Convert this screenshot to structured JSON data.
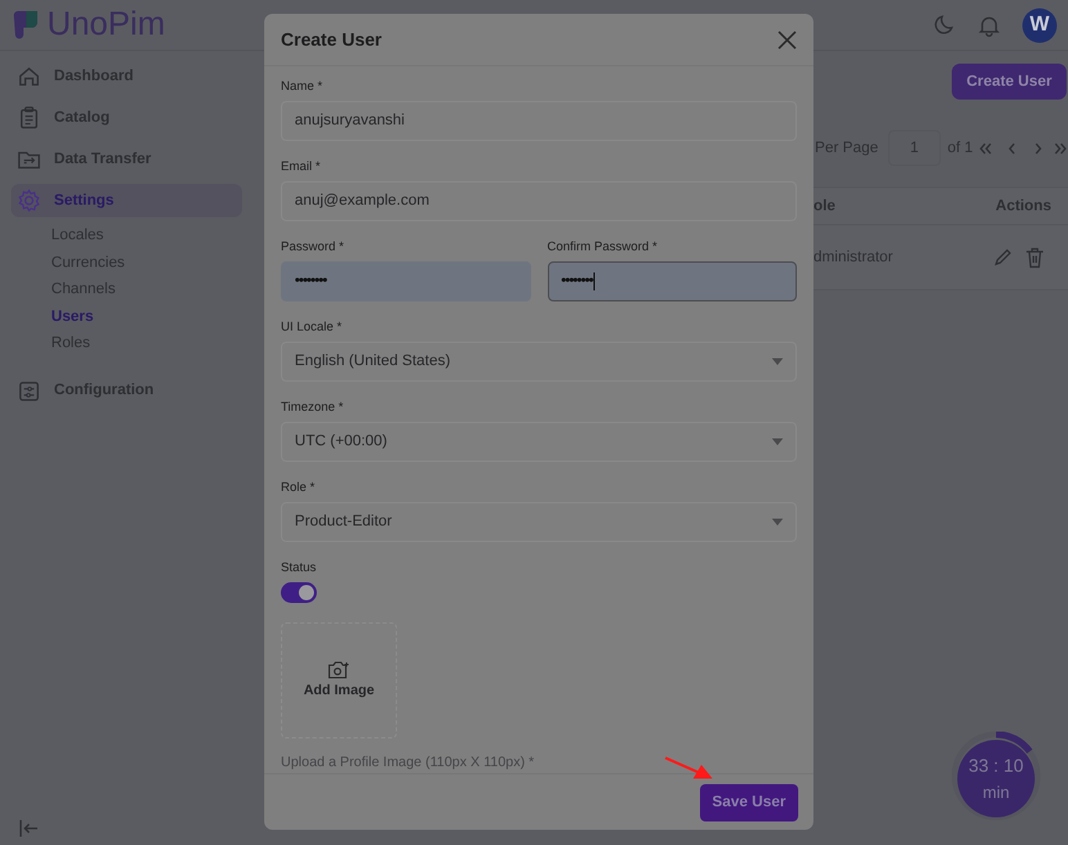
{
  "header": {
    "logo": "UnoPim",
    "avatar": "W"
  },
  "sidebar": {
    "items": [
      {
        "label": "Dashboard",
        "selected": false
      },
      {
        "label": "Catalog",
        "selected": false
      },
      {
        "label": "Data Transfer",
        "selected": false
      },
      {
        "label": "Settings",
        "selected": true,
        "children": [
          {
            "label": "Locales",
            "selected": false
          },
          {
            "label": "Currencies",
            "selected": false
          },
          {
            "label": "Channels",
            "selected": false
          },
          {
            "label": "Users",
            "selected": true
          },
          {
            "label": "Roles",
            "selected": false
          }
        ]
      },
      {
        "label": "Configuration",
        "selected": false
      }
    ]
  },
  "page": {
    "create_button": "Create User",
    "per_page_label": "Per Page",
    "per_page": "1",
    "page_count": "of 1",
    "table": {
      "columns": [
        "ole",
        "Actions"
      ],
      "rows": [
        {
          "cells": [
            "dministrator"
          ]
        }
      ]
    }
  },
  "modal": {
    "title": "Create User",
    "fields": [
      {
        "kind": "text",
        "label": "Name *",
        "value": "anujsuryavanshi",
        "focused": false
      },
      {
        "kind": "text",
        "label": "Email *",
        "value": "anuj@example.com",
        "focused": false
      },
      {
        "kind": "password",
        "label": "Password *",
        "value": "••••••••",
        "focused": false
      },
      {
        "kind": "password",
        "label": "Confirm Password *",
        "value": "••••••••",
        "focused": true
      },
      {
        "kind": "select",
        "label": "UI Locale *",
        "value": "English (United States)",
        "focused": false
      },
      {
        "kind": "select",
        "label": "Timezone *",
        "value": "UTC (+00:00)",
        "focused": false
      },
      {
        "kind": "select",
        "label": "Role *",
        "value": "Product-Editor",
        "focused": false
      }
    ],
    "status": {
      "label": "Status",
      "on": true
    },
    "image": {
      "button": "Add Image",
      "hint": "Upload a Profile Image (110px X 110px) *"
    },
    "save_button": "Save User"
  },
  "timer": {
    "time": "33 : 10",
    "unit": "min"
  }
}
